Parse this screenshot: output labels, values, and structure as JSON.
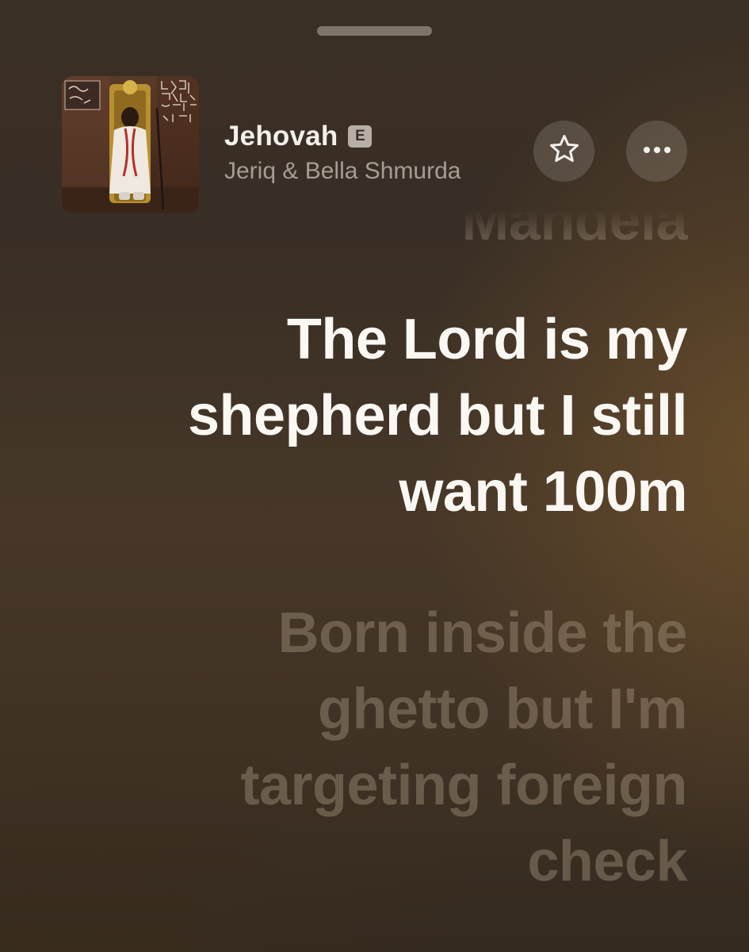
{
  "sheet": {
    "grabber": "sheet-grabber"
  },
  "now_playing": {
    "title": "Jehovah",
    "explicit_badge": "E",
    "artist": "Jeriq & Bella Shmurda",
    "favorite_icon": "star-icon",
    "more_icon": "ellipsis-icon"
  },
  "lyrics": {
    "previous": "Mandela",
    "current": "The Lord is my shepherd but I still want 100m",
    "next": "Born inside the ghetto but I'm targeting foreign check"
  },
  "colors": {
    "background": "#3a2f25",
    "accent_glow": "#7a582c",
    "current_lyric": "#fbf8f4",
    "upcoming_lyric": "#aa9884",
    "artist_text": "#a69d94"
  }
}
